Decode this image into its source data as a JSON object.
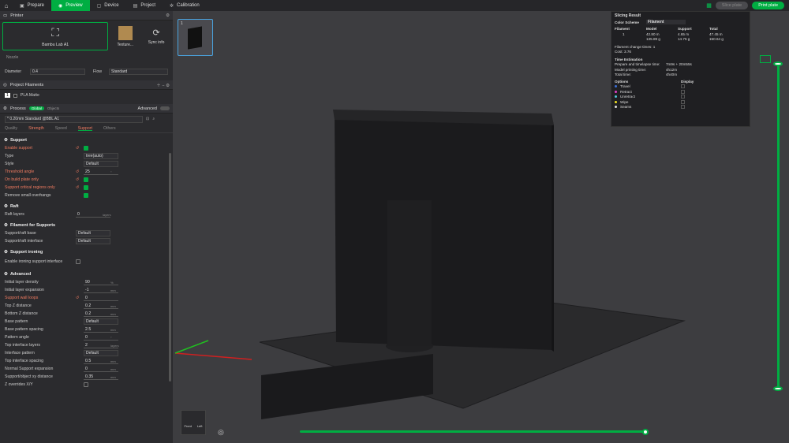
{
  "topbar": {
    "tabs": [
      {
        "label": "Prepare",
        "icon": "cube-icon"
      },
      {
        "label": "Preview",
        "icon": "eye-icon",
        "active": true
      },
      {
        "label": "Device",
        "icon": "device-icon"
      },
      {
        "label": "Project",
        "icon": "project-icon"
      },
      {
        "label": "Calibration",
        "icon": "gear-icon"
      }
    ],
    "slice_label": "Slice plate",
    "print_label": "Print plate"
  },
  "printer": {
    "section": "Printer",
    "name": "Bambu Lab A1",
    "texture": "Texture...",
    "sync": "Sync info",
    "nozzle_label": "Nozzle",
    "diameter_label": "Diameter",
    "diameter_value": "0.4",
    "flow_label": "Flow",
    "flow_value": "Standard"
  },
  "filaments": {
    "section": "Project Filaments",
    "index": "1",
    "name": "PLA Matte"
  },
  "process": {
    "section": "Process",
    "global": "Global",
    "objects": "Objects",
    "advanced": "Advanced",
    "preset": "* 0.20mm Standard @BBL A1",
    "tabs": [
      "Quality",
      "Strength",
      "Speed",
      "Support",
      "Others"
    ]
  },
  "support": {
    "title": "Support",
    "rows": [
      {
        "label": "Enable support",
        "type": "check",
        "on": true,
        "red": true,
        "reset": true
      },
      {
        "label": "Type",
        "type": "select",
        "value": "tree(auto)"
      },
      {
        "label": "Style",
        "type": "select",
        "value": "Default"
      },
      {
        "label": "Threshold angle",
        "type": "input",
        "value": "25",
        "unit": "°",
        "red": true,
        "reset": true
      },
      {
        "label": "On build plate only",
        "type": "check",
        "on": true,
        "red": true,
        "reset": true
      },
      {
        "label": "Support critical regions only",
        "type": "check",
        "on": true,
        "red": true,
        "reset": true
      },
      {
        "label": "Remove small overhangs",
        "type": "check",
        "on": true
      }
    ]
  },
  "raft": {
    "title": "Raft",
    "layers_label": "Raft layers",
    "layers_value": "0",
    "unit": "layers"
  },
  "filament_supports": {
    "title": "Filament for Supports",
    "base_label": "Support/raft base",
    "base_value": "Default",
    "iface_label": "Support/raft interface",
    "iface_value": "Default"
  },
  "ironing": {
    "title": "Support ironing",
    "label": "Enable ironing support interface"
  },
  "advanced": {
    "title": "Advanced",
    "rows": [
      {
        "label": "Initial layer density",
        "value": "90",
        "unit": "%"
      },
      {
        "label": "Initial layer expansion",
        "value": "-1",
        "unit": "mm"
      },
      {
        "label": "Support wall loops",
        "value": "0",
        "red": true,
        "reset": true
      },
      {
        "label": "Top Z distance",
        "value": "0.2",
        "unit": "mm"
      },
      {
        "label": "Bottom Z distance",
        "value": "0.2",
        "unit": "mm"
      },
      {
        "label": "Base pattern",
        "value": "Default",
        "select": true
      },
      {
        "label": "Base pattern spacing",
        "value": "2.5",
        "unit": "mm"
      },
      {
        "label": "Pattern angle",
        "value": "0",
        "unit": "°"
      },
      {
        "label": "Top interface layers",
        "value": "2",
        "unit": "layers"
      },
      {
        "label": "Interface pattern",
        "value": "Default",
        "select": true
      },
      {
        "label": "Top interface spacing",
        "value": "0.5",
        "unit": "mm"
      },
      {
        "label": "Normal Support expansion",
        "value": "0",
        "unit": "mm"
      },
      {
        "label": "Support/object xy distance",
        "value": "0.35",
        "unit": "mm"
      },
      {
        "label": "Z overrides X/Y",
        "check": true
      }
    ]
  },
  "slicing": {
    "title": "Slicing Result",
    "scheme_label": "Color Scheme",
    "scheme_value": "Filament",
    "headers": [
      "Filament",
      "Model",
      "Support",
      "Total"
    ],
    "f_index": "1",
    "model_m": "42.80 m",
    "model_g": "135.89 g",
    "support_m": "4.65 m",
    "support_g": "14.75 g",
    "total_m": "47.45 m",
    "total_g": "150.64 g",
    "change_times": "Filament change times:  1",
    "cost": "Cost:  3.76",
    "time_title": "Time Estimation",
    "prep_label": "Prepare and timelapse time:",
    "prep_value": "7m9s + 20m55s",
    "model_time_label": "Model printing time:",
    "model_time_value": "4h12m",
    "total_label": "Total time:",
    "total_value": "4h40m",
    "options_label": "Options",
    "display_label": "Display",
    "options": [
      {
        "name": "Travel",
        "color": "#3a6fd8"
      },
      {
        "name": "Retract",
        "color": "#e040c8"
      },
      {
        "name": "Unretract",
        "color": "#50c8d8"
      },
      {
        "name": "Wipe",
        "color": "#f0e020"
      },
      {
        "name": "Seams",
        "color": "#e0e0e0"
      }
    ]
  },
  "view": {
    "thumb_index": "1",
    "cube_front": "Front",
    "cube_left": "Left"
  },
  "accent": "#00ae42"
}
